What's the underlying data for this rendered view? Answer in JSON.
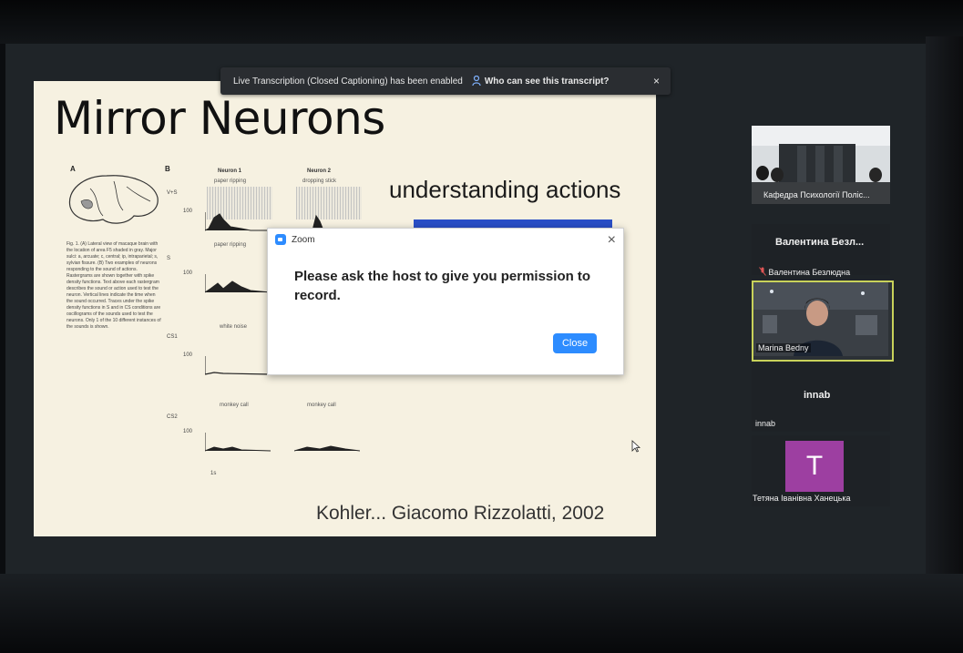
{
  "banner": {
    "message": "Live Transcription (Closed Captioning) has been enabled",
    "info_link": "Who can see this transcript?",
    "close": "×"
  },
  "slide": {
    "title": "Mirror Neurons",
    "subtitle": "understanding actions",
    "citation": "Kohler... Giacomo Rizzolatti, 2002",
    "figure": {
      "panel_a": "A",
      "panel_b": "B",
      "neuron1": "Neuron 1",
      "neuron2": "Neuron 2",
      "cond_paper": "paper ripping",
      "cond_stick": "dropping stick",
      "cond_paper2": "paper ripping",
      "cond_white": "white noise",
      "cond_monkey1": "monkey call",
      "cond_monkey2": "monkey call",
      "row_vs": "V+S",
      "row_s": "S",
      "row_cs1": "CS1",
      "row_cs2": "CS2",
      "y100a": "100",
      "y100b": "100",
      "y100c": "100",
      "y100d": "100",
      "time": "1s",
      "caption": "Fig. 1. (A) Lateral view of macaque brain with the location of area F5 shaded in gray. Major sulci: a, arcuate; c, central; ip, intraparietal; s, sylvian fissure. (B) Two examples of neurons responding to the sound of actions. Rastergrams are shown together with spike density functions. Text above each rastergram describes the sound or action used to test the neuron. Vertical lines indicate the time when the sound occurred. Traces under the spike density functions in S and in CS conditions are oscillograms of the sounds used to test the neurons. Only 1 of the 10 different instances of the sounds is shown."
    }
  },
  "dialog": {
    "app_name": "Zoom",
    "message": "Please ask the host to give you permission to record.",
    "close_button": "Close",
    "close_x": "×"
  },
  "participants": {
    "tile1_label": "Кафедра Психології Поліс...",
    "tile2_name": "Валентина  Безл...",
    "tile2_label": "Валентина Безлюдна",
    "tile3_label": "Marina Bedny",
    "tile4_name": "innab",
    "tile4_label": "innab",
    "tile5_avatar": "T",
    "tile5_label": "Тетяна Іванівна Ханецька"
  },
  "colors": {
    "zoom_blue": "#2d8cff",
    "active_speaker_border": "#c8d25a",
    "avatar_purple": "#9d3fa1",
    "slide_bar": "#2a4fc6"
  }
}
